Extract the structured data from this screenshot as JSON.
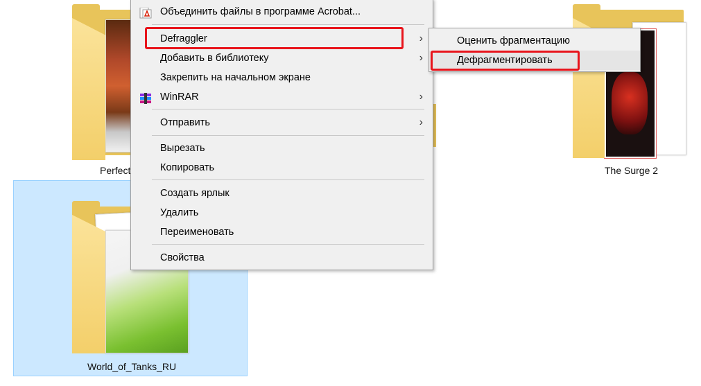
{
  "desktop": {
    "folders": [
      {
        "name": "Perfect",
        "selected": false
      },
      {
        "name": "The Surge 2",
        "selected": false
      },
      {
        "name": "World_of_Tanks_RU",
        "selected": true
      }
    ]
  },
  "context_menu": {
    "items": [
      {
        "label": "Объединить файлы в программе Acrobat...",
        "icon": "acrobat-icon",
        "submenu": false
      },
      {
        "label": "Defraggler",
        "icon": "",
        "submenu": true,
        "highlighted": true
      },
      {
        "label": "Добавить в библиотеку",
        "icon": "",
        "submenu": true
      },
      {
        "label": "Закрепить на начальном экране",
        "icon": "",
        "submenu": false
      },
      {
        "label": "WinRAR",
        "icon": "winrar-icon",
        "submenu": true
      },
      {
        "label": "Отправить",
        "icon": "",
        "submenu": true
      },
      {
        "label": "Вырезать",
        "icon": "",
        "submenu": false
      },
      {
        "label": "Копировать",
        "icon": "",
        "submenu": false
      },
      {
        "label": "Создать ярлык",
        "icon": "",
        "submenu": false
      },
      {
        "label": "Удалить",
        "icon": "",
        "submenu": false
      },
      {
        "label": "Переименовать",
        "icon": "",
        "submenu": false
      },
      {
        "label": "Свойства",
        "icon": "",
        "submenu": false
      }
    ]
  },
  "submenu": {
    "items": [
      {
        "label": "Оценить фрагментацию"
      },
      {
        "label": "Дефрагментировать",
        "highlighted": true
      }
    ]
  },
  "colors": {
    "highlight_border": "#e8141b",
    "selection_bg": "#cce8ff",
    "menu_bg": "#f0f0f0"
  }
}
